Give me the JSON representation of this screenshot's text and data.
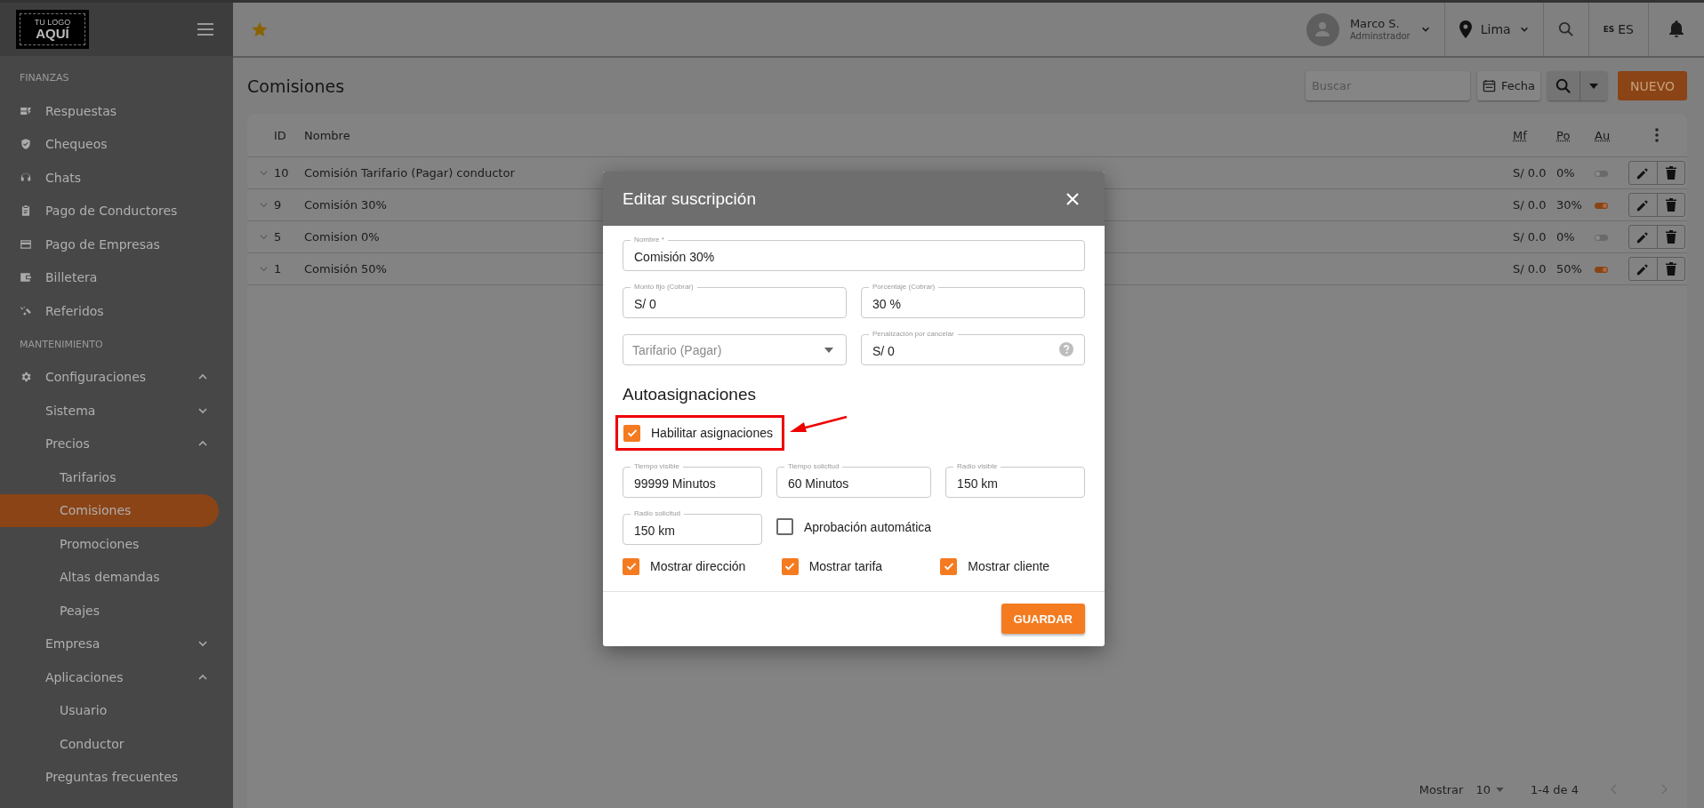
{
  "top_bar": {
    "user": {
      "name": "Marco S.",
      "role": "Adminstrador"
    },
    "city": "Lima",
    "language": {
      "badge": "ES",
      "label": "ES"
    }
  },
  "sidebar": {
    "logo": [
      "TU LOGO",
      "AQUÍ"
    ],
    "sections": [
      {
        "title": "FINANZAS",
        "items": [
          {
            "label": "Respuestas",
            "selected": false
          },
          {
            "label": "Chequeos",
            "selected": false
          },
          {
            "label": "Chats",
            "selected": false
          },
          {
            "label": "Pago de Conductores",
            "selected": false
          },
          {
            "label": "Pago de Empresas",
            "selected": false
          },
          {
            "label": "Billetera",
            "selected": false
          },
          {
            "label": "Referidos",
            "selected": false
          }
        ]
      },
      {
        "title": "MANTENIMIENTO",
        "items": [
          {
            "label": "Configuraciones",
            "selected": false,
            "expanded": true,
            "children": [
              {
                "label": "Sistema",
                "selected": false,
                "expanded": false
              },
              {
                "label": "Precios",
                "selected": false,
                "expanded": true,
                "children": [
                  {
                    "label": "Tarifarios",
                    "selected": false
                  },
                  {
                    "label": "Comisiones",
                    "selected": true
                  },
                  {
                    "label": "Promociones",
                    "selected": false
                  },
                  {
                    "label": "Altas demandas",
                    "selected": false
                  },
                  {
                    "label": "Peajes",
                    "selected": false
                  }
                ]
              },
              {
                "label": "Empresa",
                "selected": false,
                "expanded": false
              },
              {
                "label": "Aplicaciones",
                "selected": false,
                "expanded": true,
                "children": [
                  {
                    "label": "Usuario",
                    "selected": false
                  },
                  {
                    "label": "Conductor",
                    "selected": false
                  }
                ]
              },
              {
                "label": "Preguntas frecuentes",
                "selected": false
              }
            ]
          }
        ]
      }
    ]
  },
  "page": {
    "title": "Comisiones",
    "search": {
      "placeholder": "Buscar"
    },
    "date_button": "Fecha",
    "new_button": "NUEVO"
  },
  "table": {
    "columns": [
      "ID",
      "Nombre",
      "Mf",
      "Po",
      "Au"
    ],
    "rows": [
      {
        "id": "10",
        "name": "Comisión Tarifario (Pagar) conductor",
        "mf": "S/ 0.0",
        "po": "0%",
        "au": false
      },
      {
        "id": "9",
        "name": "Comisión 30%",
        "mf": "S/ 0.0",
        "po": "30%",
        "au": true
      },
      {
        "id": "5",
        "name": "Comision 0%",
        "mf": "S/ 0.0",
        "po": "0%",
        "au": false
      },
      {
        "id": "1",
        "name": "Comisión 50%",
        "mf": "S/ 0.0",
        "po": "50%",
        "au": true
      }
    ]
  },
  "pagination": {
    "show_label": "Mostrar",
    "page_size": "10",
    "range": "1-4 de 4"
  },
  "dialog": {
    "title": "Editar suscripción",
    "name_field": {
      "label": "Nombre *",
      "value": "Comisión 30%"
    },
    "fixed_amount_field": {
      "label": "Monto fijo (Cobrar)",
      "value": "S/ 0"
    },
    "percentage_field": {
      "label": "Porcentaje (Cobrar)",
      "value": "30 %"
    },
    "tariff_select": {
      "placeholder": "Tarifario (Pagar)"
    },
    "penalty_field": {
      "label": "Penalización por cancelar",
      "value": "S/ 0"
    },
    "section_title": "Autoasignaciones",
    "enable_assignments": {
      "label": "Habilitar asignaciones",
      "checked": true,
      "highlighted": true
    },
    "assignment_fields": [
      {
        "label": "Tiempo visible",
        "value": "99999 Minutos"
      },
      {
        "label": "Tiempo solicitud",
        "value": "60 Minutos"
      },
      {
        "label": "Radio visible",
        "value": "150 km"
      },
      {
        "label": "Radio solicitud",
        "value": "150 km"
      }
    ],
    "auto_approval": {
      "label": "Aprobación automática",
      "checked": false
    },
    "display_options": [
      {
        "label": "Mostrar dirección",
        "checked": true
      },
      {
        "label": "Mostrar tarifa",
        "checked": true
      },
      {
        "label": "Mostrar cliente",
        "checked": true
      }
    ],
    "save_button": "GUARDAR"
  }
}
